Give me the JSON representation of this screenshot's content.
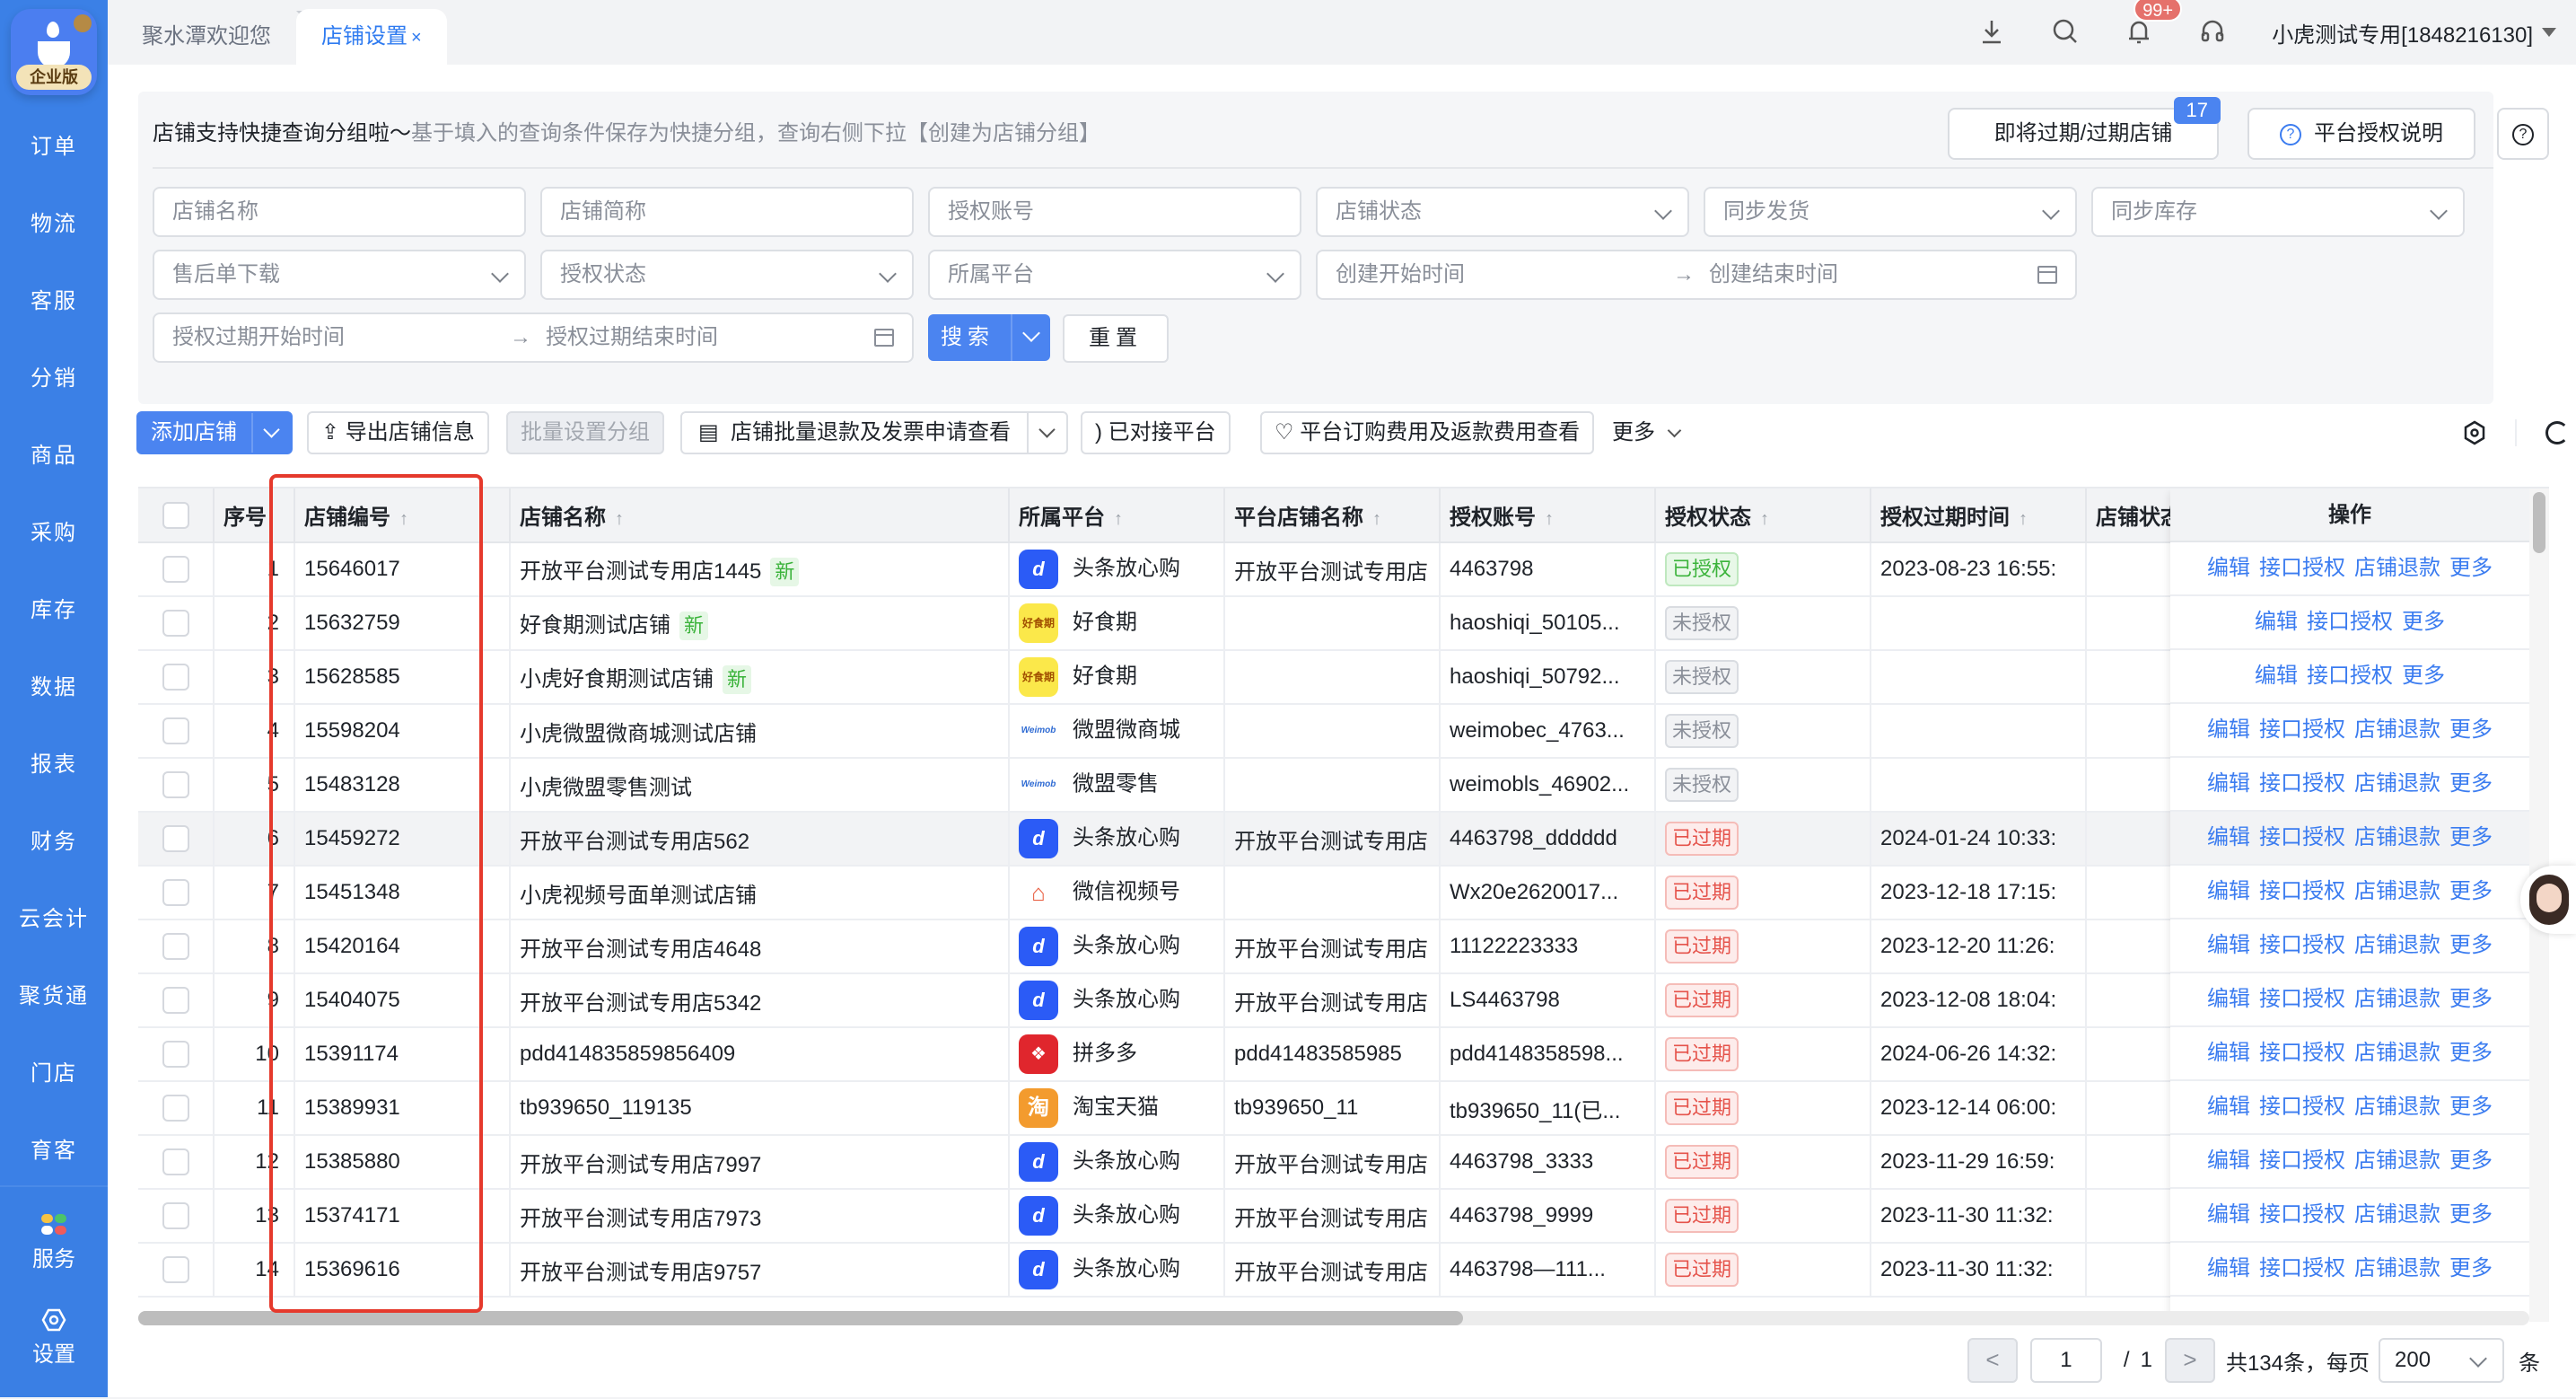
{
  "app": {
    "logo_badge": "企业版"
  },
  "sidebar": {
    "items": [
      {
        "label": "订单"
      },
      {
        "label": "物流"
      },
      {
        "label": "客服"
      },
      {
        "label": "分销"
      },
      {
        "label": "商品"
      },
      {
        "label": "采购"
      },
      {
        "label": "库存"
      },
      {
        "label": "数据"
      },
      {
        "label": "报表"
      },
      {
        "label": "财务"
      },
      {
        "label": "云会计"
      },
      {
        "label": "聚货通"
      },
      {
        "label": "门店"
      },
      {
        "label": "育客"
      }
    ],
    "bottom": [
      {
        "label": "服务",
        "icon": "apps-icon"
      },
      {
        "label": "设置",
        "icon": "gear-icon"
      }
    ]
  },
  "tabs": [
    {
      "label": "聚水潭欢迎您",
      "active": false
    },
    {
      "label": "店铺设置",
      "active": true,
      "close": "×"
    }
  ],
  "header": {
    "notification_count": "99+",
    "user": "小虎测试专用[1848216130]"
  },
  "notice": {
    "title": "店铺支持快捷查询分组啦～",
    "detail": "基于填入的查询条件保存为快捷分组，查询右侧下拉【创建为店铺分组】"
  },
  "top_buttons": {
    "expiring": "即将过期/过期店铺",
    "expiring_count": "17",
    "auth_help": "平台授权说明"
  },
  "filters": {
    "shop_name": "店铺名称",
    "shop_short": "店铺简称",
    "auth_account": "授权账号",
    "shop_status": "店铺状态",
    "sync_ship": "同步发货",
    "sync_stock": "同步库存",
    "aftersale_download": "售后单下载",
    "auth_status": "授权状态",
    "platform": "所属平台",
    "create_start": "创建开始时间",
    "create_end": "创建结束时间",
    "auth_exp_start": "授权过期开始时间",
    "auth_exp_end": "授权过期结束时间",
    "range_arrow": "→",
    "search": "搜索",
    "reset": "重置"
  },
  "toolbar": {
    "add_shop": "添加店铺",
    "export": "导出店铺信息",
    "batch_group": "批量设置分组",
    "batch_refund": "店铺批量退款及发票申请查看",
    "connected": "已对接平台",
    "fees": "平台订购费用及返款费用查看",
    "more": "更多"
  },
  "table": {
    "columns": [
      "序号",
      "店铺编号",
      "店铺名称",
      "所属平台",
      "平台店铺名称",
      "授权账号",
      "授权状态",
      "授权过期时间",
      "店铺状态",
      "操作"
    ],
    "rows": [
      {
        "idx": "1",
        "code": "15646017",
        "name": "开放平台测试专用店1445",
        "new": "新",
        "platform": "头条放心购",
        "picon": "dy",
        "pshop": "开放平台测试专用店",
        "account": "4463798",
        "status": "已授权",
        "stype": "ok",
        "expire": "2023-08-23 16:55:",
        "ops": [
          "编辑",
          "接口授权",
          "店铺退款",
          "更多"
        ]
      },
      {
        "idx": "2",
        "code": "15632759",
        "name": "好食期测试店铺",
        "new": "新",
        "platform": "好食期",
        "picon": "hsq",
        "pshop": "",
        "account": "haoshiqi_50105...",
        "status": "未授权",
        "stype": "no",
        "expire": "",
        "ops": [
          "编辑",
          "接口授权",
          "更多"
        ]
      },
      {
        "idx": "3",
        "code": "15628585",
        "name": "小虎好食期测试店铺",
        "new": "新",
        "platform": "好食期",
        "picon": "hsq",
        "pshop": "",
        "account": "haoshiqi_50792...",
        "status": "未授权",
        "stype": "no",
        "expire": "",
        "ops": [
          "编辑",
          "接口授权",
          "更多"
        ]
      },
      {
        "idx": "4",
        "code": "15598204",
        "name": "小虎微盟微商城测试店铺",
        "new": "",
        "platform": "微盟微商城",
        "picon": "wm",
        "pshop": "",
        "account": "weimobec_4763...",
        "status": "未授权",
        "stype": "no",
        "expire": "",
        "ops": [
          "编辑",
          "接口授权",
          "店铺退款",
          "更多"
        ]
      },
      {
        "idx": "5",
        "code": "15483128",
        "name": "小虎微盟零售测试",
        "new": "",
        "platform": "微盟零售",
        "picon": "wm",
        "pshop": "",
        "account": "weimobls_46902...",
        "status": "未授权",
        "stype": "no",
        "expire": "",
        "ops": [
          "编辑",
          "接口授权",
          "店铺退款",
          "更多"
        ]
      },
      {
        "idx": "6",
        "code": "15459272",
        "name": "开放平台测试专用店562",
        "new": "",
        "platform": "头条放心购",
        "picon": "dy",
        "pshop": "开放平台测试专用店",
        "account": "4463798_dddddd",
        "status": "已过期",
        "stype": "exp",
        "expire": "2024-01-24 10:33:",
        "ops": [
          "编辑",
          "接口授权",
          "店铺退款",
          "更多"
        ],
        "highlight": true
      },
      {
        "idx": "7",
        "code": "15451348",
        "name": "小虎视频号面单测试店铺",
        "new": "",
        "platform": "微信视频号",
        "picon": "wx",
        "pshop": "",
        "account": "Wx20e2620017...",
        "status": "已过期",
        "stype": "exp",
        "expire": "2023-12-18 17:15:",
        "ops": [
          "编辑",
          "接口授权",
          "店铺退款",
          "更多"
        ]
      },
      {
        "idx": "8",
        "code": "15420164",
        "name": "开放平台测试专用店4648",
        "new": "",
        "platform": "头条放心购",
        "picon": "dy",
        "pshop": "开放平台测试专用店",
        "account": "11122223333",
        "status": "已过期",
        "stype": "exp",
        "expire": "2023-12-20 11:26:",
        "ops": [
          "编辑",
          "接口授权",
          "店铺退款",
          "更多"
        ]
      },
      {
        "idx": "9",
        "code": "15404075",
        "name": "开放平台测试专用店5342",
        "new": "",
        "platform": "头条放心购",
        "picon": "dy",
        "pshop": "开放平台测试专用店",
        "account": "LS4463798",
        "status": "已过期",
        "stype": "exp",
        "expire": "2023-12-08 18:04:",
        "ops": [
          "编辑",
          "接口授权",
          "店铺退款",
          "更多"
        ]
      },
      {
        "idx": "10",
        "code": "15391174",
        "name": "pdd414835859856409",
        "new": "",
        "platform": "拼多多",
        "picon": "pdd",
        "pshop": "pdd41483585985",
        "account": "pdd4148358598...",
        "status": "已过期",
        "stype": "exp",
        "expire": "2024-06-26 14:32:",
        "ops": [
          "编辑",
          "接口授权",
          "店铺退款",
          "更多"
        ]
      },
      {
        "idx": "11",
        "code": "15389931",
        "name": "tb939650_119135",
        "new": "",
        "platform": "淘宝天猫",
        "picon": "tb",
        "pshop": "tb939650_11",
        "account": "tb939650_11(已...",
        "status": "已过期",
        "stype": "exp",
        "expire": "2023-12-14 06:00:",
        "ops": [
          "编辑",
          "接口授权",
          "店铺退款",
          "更多"
        ]
      },
      {
        "idx": "12",
        "code": "15385880",
        "name": "开放平台测试专用店7997",
        "new": "",
        "platform": "头条放心购",
        "picon": "dy",
        "pshop": "开放平台测试专用店",
        "account": "4463798_3333",
        "status": "已过期",
        "stype": "exp",
        "expire": "2023-11-29 16:59:",
        "ops": [
          "编辑",
          "接口授权",
          "店铺退款",
          "更多"
        ]
      },
      {
        "idx": "13",
        "code": "15374171",
        "name": "开放平台测试专用店7973",
        "new": "",
        "platform": "头条放心购",
        "picon": "dy",
        "pshop": "开放平台测试专用店",
        "account": "4463798_9999",
        "status": "已过期",
        "stype": "exp",
        "expire": "2023-11-30 11:32:",
        "ops": [
          "编辑",
          "接口授权",
          "店铺退款",
          "更多"
        ]
      },
      {
        "idx": "14",
        "code": "15369616",
        "name": "开放平台测试专用店9757",
        "new": "",
        "platform": "头条放心购",
        "picon": "dy",
        "pshop": "开放平台测试专用店",
        "account": "4463798—111...",
        "status": "已过期",
        "stype": "exp",
        "expire": "2023-11-30 11:32:",
        "ops": [
          "编辑",
          "接口授权",
          "店铺退款",
          "更多"
        ]
      }
    ]
  },
  "platform_icons": {
    "dy": "d",
    "hsq": "好食期",
    "wm": "Weimob",
    "wx": "⌂",
    "pdd": "❖",
    "tb": "淘"
  },
  "pagination": {
    "prev": "<",
    "page": "1",
    "sep": "/",
    "total_pages": "1",
    "next": ">",
    "total_text": "共134条，每页",
    "page_size": "200",
    "unit": "条"
  }
}
